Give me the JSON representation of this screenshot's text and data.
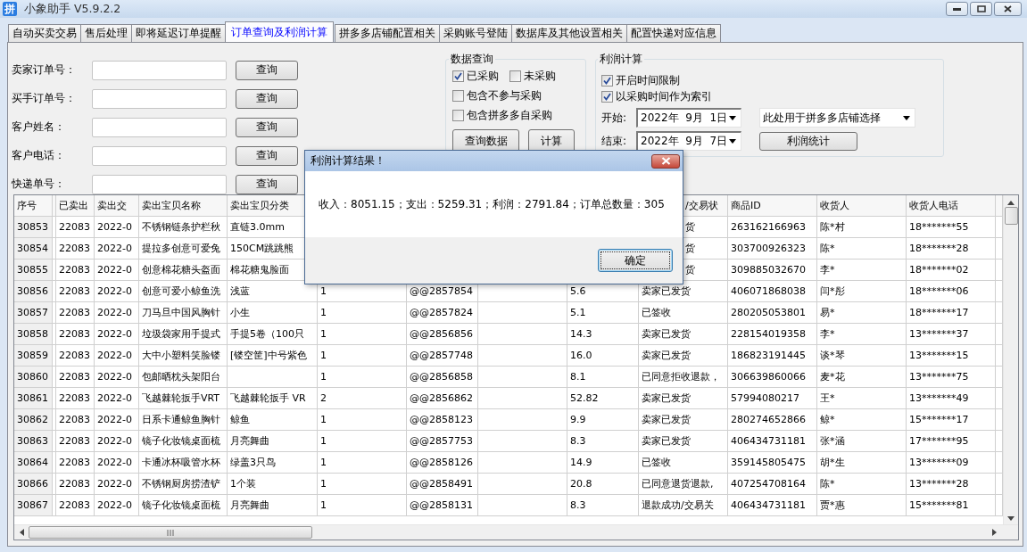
{
  "window": {
    "app_icon": "拼",
    "title": "小象助手 V5.9.2.2"
  },
  "tabs": [
    {
      "label": "自动买卖交易",
      "selected": false
    },
    {
      "label": "售后处理",
      "selected": false
    },
    {
      "label": "即将延迟订单提醒",
      "selected": false
    },
    {
      "label": "订单查询及利润计算",
      "selected": true
    },
    {
      "label": "拼多多店铺配置相关",
      "selected": false
    },
    {
      "label": "采购账号登陆",
      "selected": false
    },
    {
      "label": "数据库及其他设置相关",
      "selected": false
    },
    {
      "label": "配置快递对应信息",
      "selected": false
    }
  ],
  "search_form": [
    {
      "label": "卖家订单号：",
      "button": "查询"
    },
    {
      "label": "买手订单号：",
      "button": "查询"
    },
    {
      "label": "客户姓名：",
      "button": "查询"
    },
    {
      "label": "客户电话：",
      "button": "查询"
    },
    {
      "label": "快递单号：",
      "button": "查询"
    }
  ],
  "data_query": {
    "title": "数据查询",
    "option_rows": [
      [
        {
          "label": "已采购",
          "checked": true
        },
        {
          "label": "未采购",
          "checked": false
        }
      ],
      [
        {
          "label": "包含不参与采购",
          "checked": false
        }
      ],
      [
        {
          "label": "包含拼多多自采购",
          "checked": false
        }
      ]
    ],
    "buttons": [
      "查询数据",
      "计算"
    ]
  },
  "profit": {
    "title": "利润计算",
    "options": [
      {
        "label": "开启时间限制",
        "checked": true
      },
      {
        "label": "以采购时间作为索引",
        "checked": true
      }
    ],
    "start_label": "开始:",
    "start_date": "2022年  9月  1日",
    "end_label": "结束:",
    "end_date": "2022年  9月  7日",
    "shop_select": "此处用于拼多多店铺选择",
    "button": "利润统计"
  },
  "table": {
    "header": [
      "序号",
      {
        "kind": "blank"
      },
      "已卖出",
      "卖出交",
      "卖出宝贝名称",
      "卖出宝贝分类",
      {
        "kind": "hidden"
      },
      {
        "kind": "hidden"
      },
      {
        "kind": "hidden"
      },
      {
        "kind": "hidden"
      },
      {
        "text": "/交易状",
        "kind": "tail"
      },
      "商品ID",
      "收货人",
      "收货人电话"
    ],
    "rows": [
      [
        "30853",
        "",
        "22083",
        "2022-0",
        "不锈钢链条护栏秋",
        "直链3.0mm",
        {
          "kind": "hidden"
        },
        {
          "kind": "hidden"
        },
        {
          "kind": "hidden"
        },
        {
          "kind": "hidden"
        },
        {
          "text": "货",
          "kind": "tail"
        },
        "263162166963",
        "陈*村",
        "18*******55"
      ],
      [
        "30854",
        "",
        "22083",
        "2022-0",
        "提拉多创意可爱兔",
        "150CM跳跳熊",
        {
          "kind": "hidden"
        },
        {
          "kind": "hidden"
        },
        {
          "kind": "hidden"
        },
        {
          "kind": "hidden"
        },
        {
          "text": "货",
          "kind": "tail"
        },
        "303700926323",
        "陈*",
        "18*******28"
      ],
      [
        "30855",
        "",
        "22083",
        "2022-0",
        "创意棉花糖头盔面",
        "棉花糖鬼脸面",
        {
          "kind": "hidden"
        },
        {
          "kind": "hidden"
        },
        {
          "kind": "hidden"
        },
        {
          "kind": "hidden"
        },
        {
          "text": "货",
          "kind": "tail"
        },
        "309885032670",
        "李*",
        "18*******02"
      ],
      [
        "30856",
        "",
        "22083",
        "2022-0",
        "创意可爱小鲸鱼洗",
        "浅蓝",
        "1",
        "@@2857854",
        null,
        "5.6",
        "卖家已发货",
        "406071868038",
        "闫*彤",
        "18*******06"
      ],
      [
        "30857",
        "",
        "22083",
        "2022-0",
        "刀马旦中国风胸针",
        "小生",
        "1",
        "@@2857824",
        null,
        "5.1",
        "已签收",
        "280205053801",
        "易*",
        "18*******17"
      ],
      [
        "30858",
        "",
        "22083",
        "2022-0",
        "垃圾袋家用手提式",
        "手提5卷（100只",
        "1",
        "@@2856856",
        null,
        "14.3",
        "卖家已发货",
        "228154019358",
        "李*",
        "13*******37"
      ],
      [
        "30859",
        "",
        "22083",
        "2022-0",
        "大中小塑料笑脸镂",
        "[镂空筐]中号紫色",
        "1",
        "@@2857748",
        null,
        "16.0",
        "卖家已发货",
        "186823191445",
        "谈*琴",
        "13*******15"
      ],
      [
        "30860",
        "",
        "22083",
        "2022-0",
        "包邮晒枕头架阳台",
        null,
        "1",
        "@@2856858",
        null,
        "8.1",
        "已同意拒收退款，",
        "306639860066",
        "麦*花",
        "13*******75"
      ],
      [
        "30861",
        "",
        "22083",
        "2022-0",
        "飞越棘轮扳手VRT",
        "飞越棘轮扳手 VR",
        "2",
        "@@2856862",
        null,
        "52.82",
        "卖家已发货",
        "57994080217",
        "王*",
        "13*******49"
      ],
      [
        "30862",
        "",
        "22083",
        "2022-0",
        "日系卡通鲸鱼胸针",
        "鲸鱼",
        "1",
        "@@2858123",
        null,
        "9.9",
        "卖家已发货",
        "280274652866",
        "鲸*",
        "15*******17"
      ],
      [
        "30863",
        "",
        "22083",
        "2022-0",
        "镜子化妆镜桌面梳",
        "月亮舞曲",
        "1",
        "@@2857753",
        null,
        "8.3",
        "卖家已发货",
        "406434731181",
        "张*涵",
        "17*******95"
      ],
      [
        "30864",
        "",
        "22083",
        "2022-0",
        "卡通冰杯吸管水杯",
        "绿盖3只鸟",
        "1",
        "@@2858126",
        null,
        "14.9",
        "已签收",
        "359145805475",
        "胡*生",
        "13*******09"
      ],
      [
        "30866",
        "",
        "22083",
        "2022-0",
        "不锈钢厨房捞渣铲",
        "1个装",
        "1",
        "@@2858491",
        null,
        "20.8",
        "已同意退货退款,",
        "407254708164",
        "陈*",
        "13*******28"
      ],
      [
        "30867",
        "",
        "22083",
        "2022-0",
        "镜子化妆镜桌面梳",
        "月亮舞曲",
        "1",
        "@@2858131",
        null,
        "8.3",
        "退款成功/交易关",
        "406434731181",
        "贾*惠",
        "15*******81"
      ]
    ]
  },
  "dialog": {
    "title": "利润计算结果！",
    "message": "收入：8051.15；支出：5259.31；利润：2791.84；订单总数量：305",
    "button": "确定"
  }
}
